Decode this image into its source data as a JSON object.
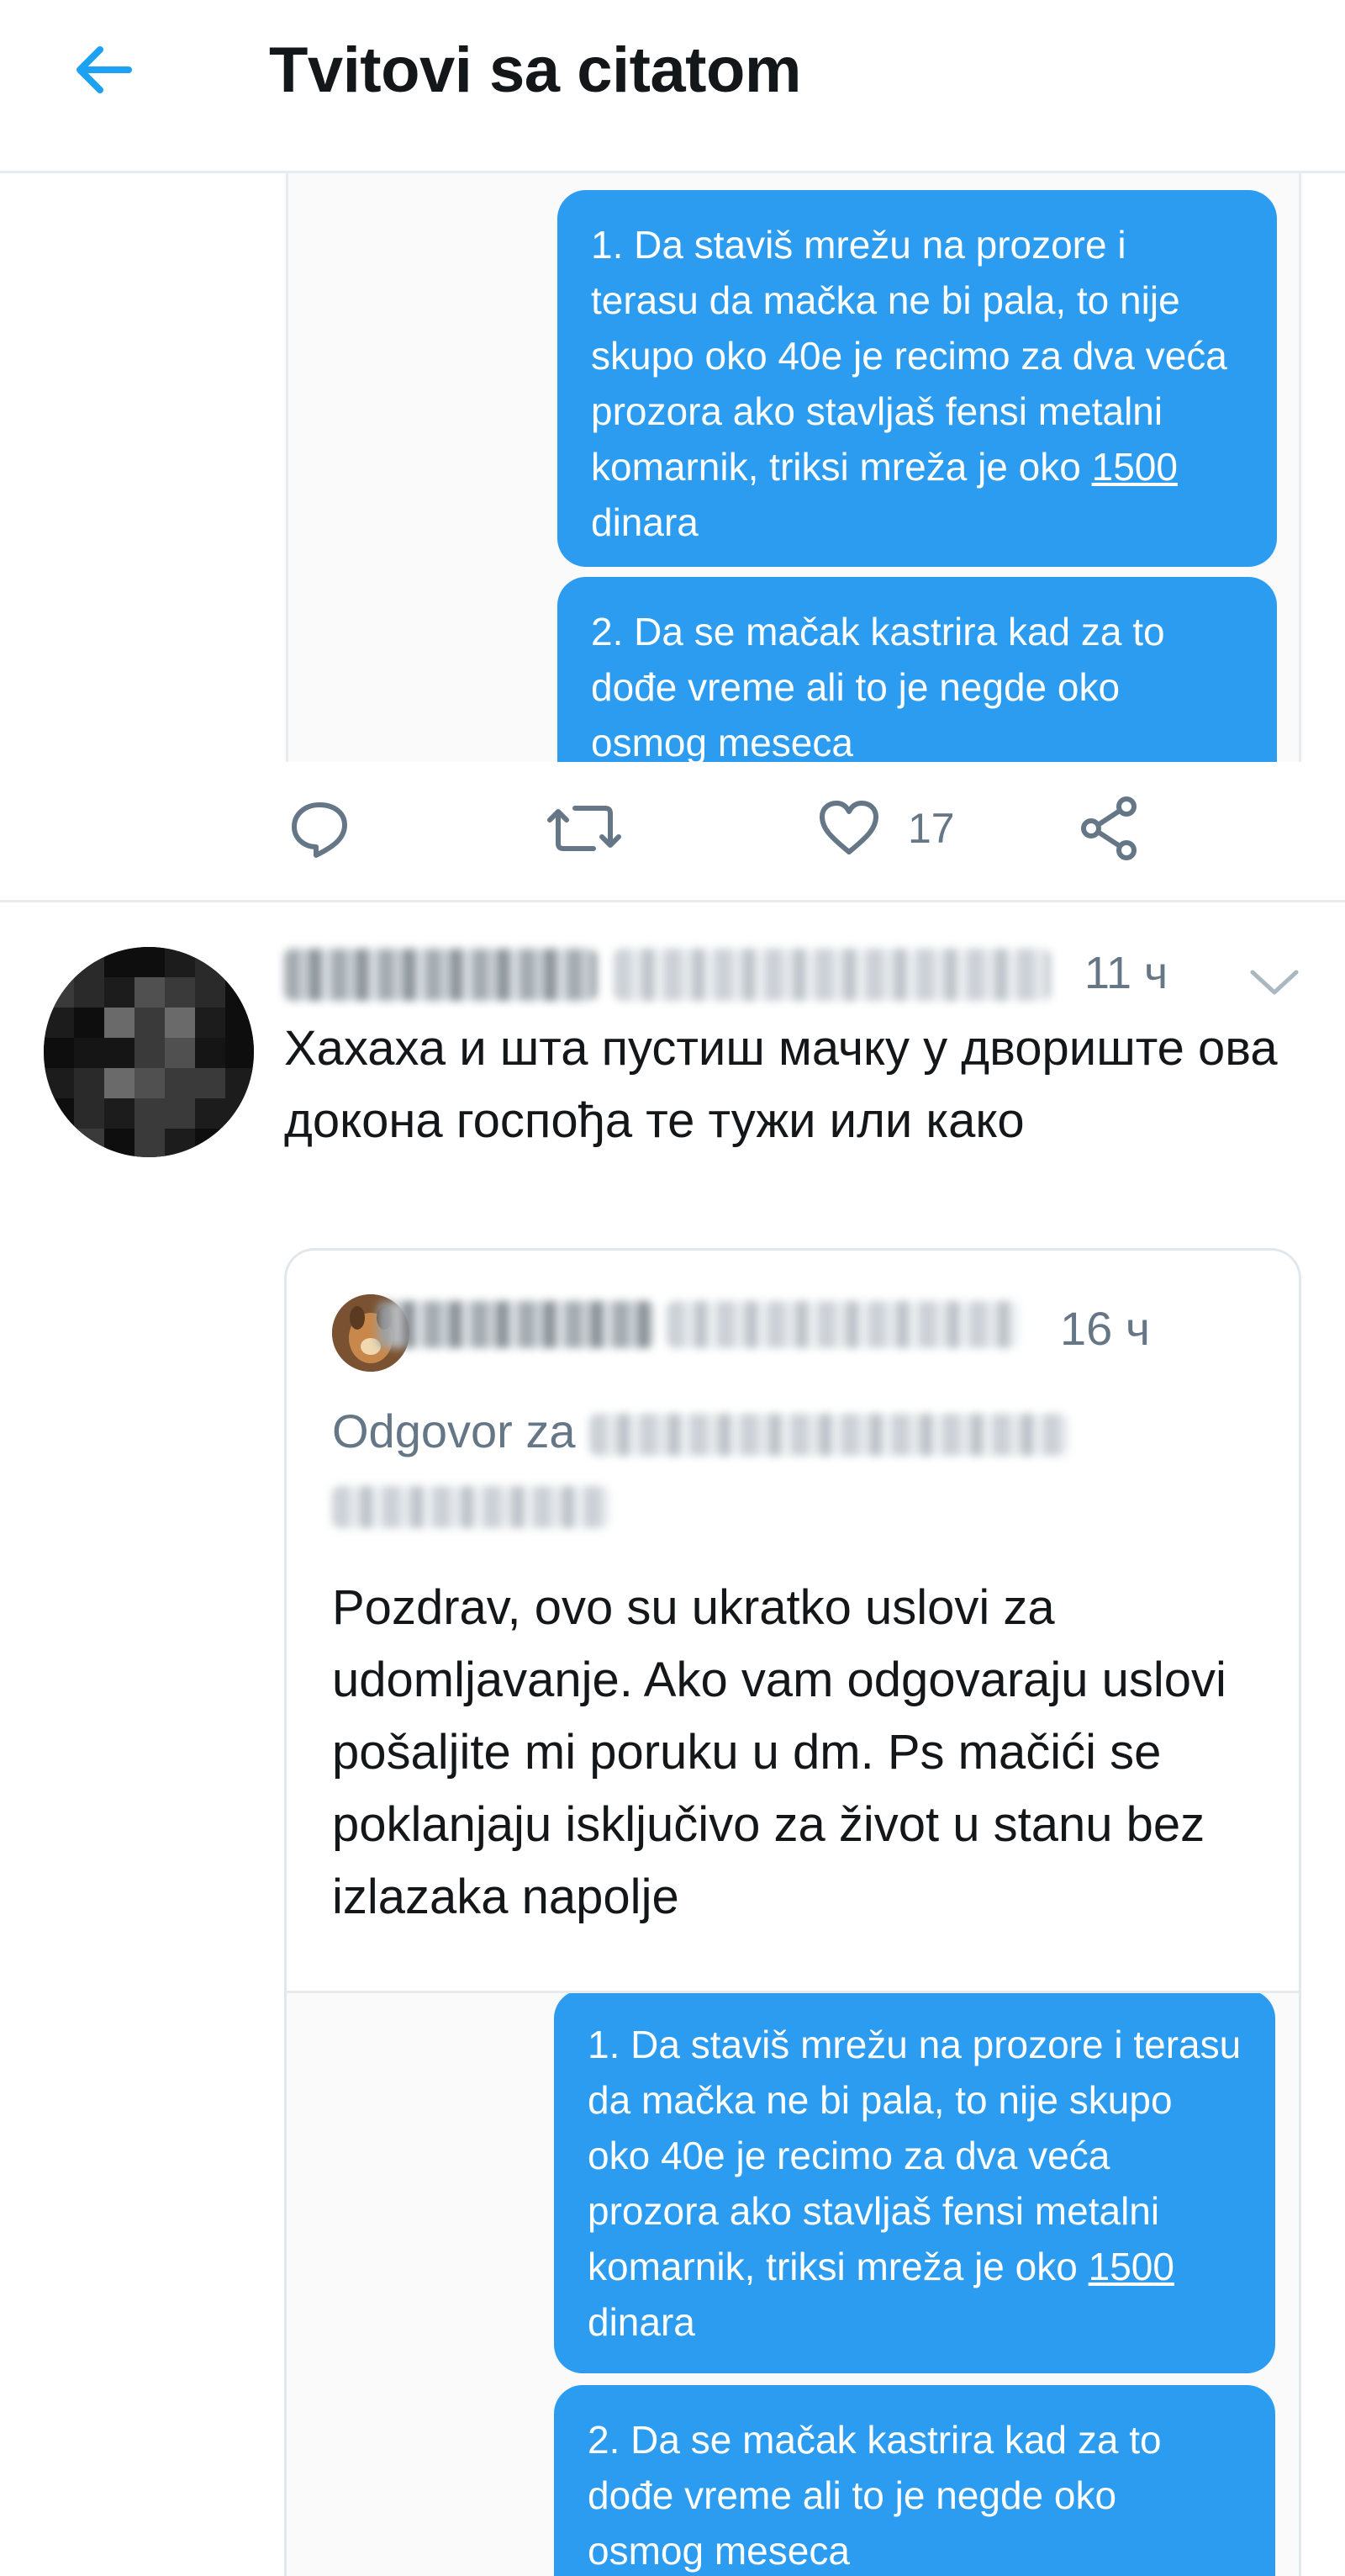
{
  "header": {
    "title": "Tvitovi sa citatom"
  },
  "fragment": {
    "bubble_1": {
      "before": "1. Da staviš mrežu na prozore i terasu da  mačka ne bi pala, to nije skupo oko 40e je recimo za dva veća prozora ako stavljaš fensi metalni komarnik, triksi mreža je oko ",
      "underlined": "1500",
      "after": " dinara"
    },
    "bubble_2": "2. Da se mačak kastrira kad za to dođe vreme ali to je negde oko osmog meseca"
  },
  "actions": {
    "like_count": "17"
  },
  "tweet": {
    "time": "11 ч",
    "text": "Хахаха и шта пустиш мачку у двориште ова докона госпођа те тужи или како"
  },
  "quoted": {
    "time": "16 ч",
    "reply_prefix": "Odgovor za",
    "body": "Pozdrav, ovo su ukratko uslovi za udomljavanje. Ako vam odgovaraju uslovi pošaljite mi poruku u dm. Ps mačići se poklanjaju isključivo za život u stanu bez izlazaka napolje"
  },
  "colors": {
    "accent": "#1da1f2",
    "bubble": "#2c9cf0",
    "muted": "#657786",
    "border": "#e6ecf0"
  }
}
